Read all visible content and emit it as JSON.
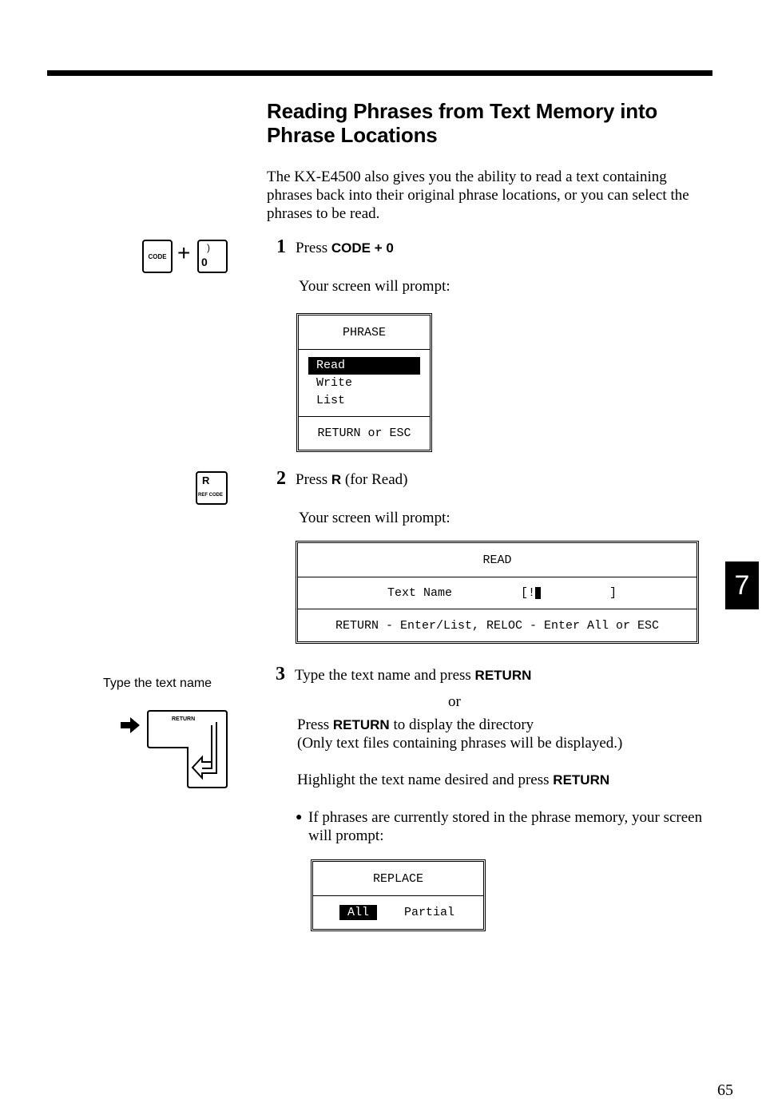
{
  "page": {
    "title": "Reading Phrases from Text Memory into Phrase Locations",
    "intro": "The KX-E4500 also gives you the ability to read a text containing phrases back into their original phrase locations, or you can select the phrases to be read.",
    "chapter_tab": "7",
    "page_number": "65"
  },
  "keys": {
    "code_key": "CODE",
    "plus": "+",
    "zero_key_top": ")",
    "zero_key_bottom": "0",
    "r_key_top": "R",
    "r_key_bottom": "REF CODE",
    "return_key": "RETURN",
    "type_caption": "Type the text name"
  },
  "steps": [
    {
      "number": "1",
      "text_prefix": "Press ",
      "text_bold": "CODE + 0",
      "prompt": "Your screen will prompt:"
    },
    {
      "number": "2",
      "text_prefix": "Press ",
      "text_bold": "R",
      "text_suffix": " (for Read)",
      "prompt": "Your screen will prompt:"
    },
    {
      "number": "3",
      "line1_prefix": "Type the text name and press ",
      "line1_bold": "RETURN",
      "or": "or",
      "line2_prefix": "Press ",
      "line2_bold": "RETURN",
      "line2_suffix": " to display the directory",
      "line3": "(Only text files containing phrases will be displayed.)",
      "line4_prefix": "Highlight the text name desired and press ",
      "line4_bold": "RETURN",
      "bullet": "If phrases are currently stored in the phrase memory, your screen will prompt:"
    }
  ],
  "screens": {
    "phrase": {
      "title": "PHRASE",
      "items": [
        "Read",
        "Write",
        "List"
      ],
      "selected_index": 0,
      "footer": "RETURN or ESC"
    },
    "read": {
      "title": "READ",
      "field_label": "Text Name",
      "field_open": "[!",
      "field_close": "]",
      "footer": "RETURN - Enter/List, RELOC - Enter All or ESC"
    },
    "replace": {
      "title": "REPLACE",
      "options": [
        "All",
        "Partial"
      ],
      "selected_index": 0
    }
  }
}
